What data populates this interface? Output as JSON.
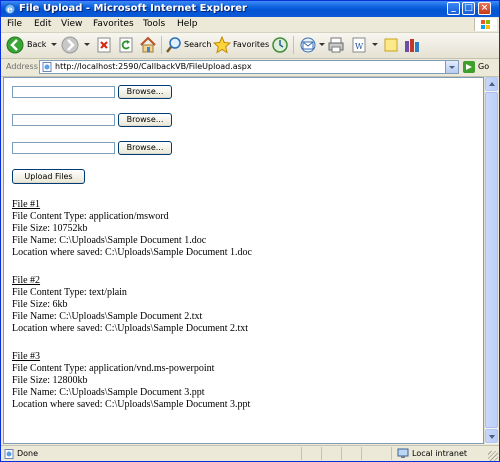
{
  "window": {
    "title": "File Upload - Microsoft Internet Explorer",
    "min_glyph": "_",
    "max_glyph": "□",
    "close_glyph": "×"
  },
  "menu": [
    "File",
    "Edit",
    "View",
    "Favorites",
    "Tools",
    "Help"
  ],
  "toolbar": {
    "back_label": "Back",
    "search_label": "Search",
    "favorites_label": "Favorites"
  },
  "address": {
    "label": "Address",
    "url": "http://localhost:2590/CallbackVB/FileUpload.aspx",
    "go_label": "Go"
  },
  "form": {
    "file_inputs": [
      {
        "value": "",
        "browse_label": "Browse..."
      },
      {
        "value": "",
        "browse_label": "Browse..."
      },
      {
        "value": "",
        "browse_label": "Browse..."
      }
    ],
    "upload_label": "Upload Files"
  },
  "results": [
    {
      "heading": "File #1",
      "content_type": "File Content Type: application/msword",
      "size": "File Size: 10752kb",
      "name": "File Name: C:\\Uploads\\Sample Document 1.doc",
      "saved": "Location where saved: C:\\Uploads\\Sample Document 1.doc"
    },
    {
      "heading": "File #2",
      "content_type": "File Content Type: text/plain",
      "size": "File Size: 6kb",
      "name": "File Name: C:\\Uploads\\Sample Document 2.txt",
      "saved": "Location where saved: C:\\Uploads\\Sample Document 2.txt"
    },
    {
      "heading": "File #3",
      "content_type": "File Content Type: application/vnd.ms-powerpoint",
      "size": "File Size: 12800kb",
      "name": "File Name: C:\\Uploads\\Sample Document 3.ppt",
      "saved": "Location where saved: C:\\Uploads\\Sample Document 3.ppt"
    }
  ],
  "status": {
    "text": "Done",
    "zone": "Local intranet"
  },
  "colors": {
    "titlebar": "#0a5fdc",
    "chrome": "#ece9d8",
    "accent_border": "#7f9db9"
  }
}
